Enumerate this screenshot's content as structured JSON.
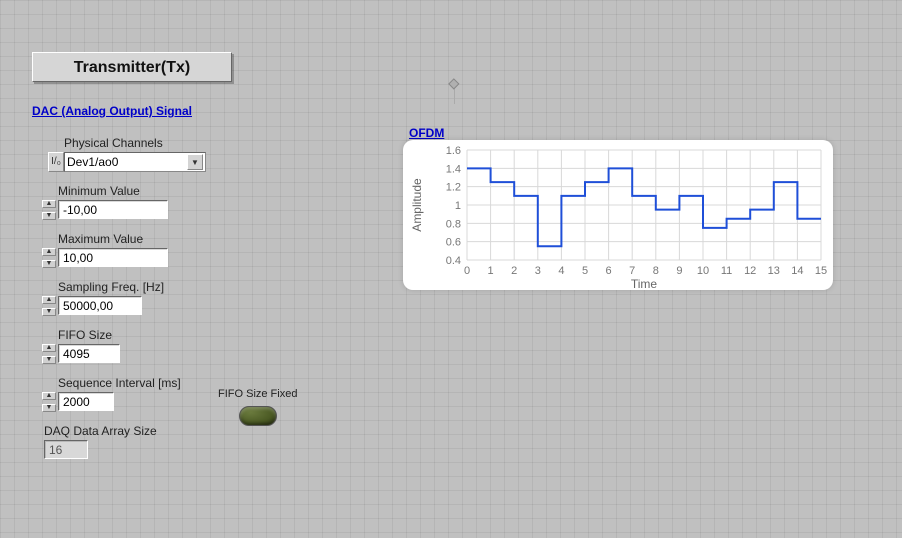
{
  "title": "Transmitter(Tx)",
  "section_header": "DAC (Analog Output) Signal",
  "channels": {
    "label": "Physical Channels",
    "value": "Dev1/ao0"
  },
  "min_value": {
    "label": "Minimum Value",
    "value": "-10,00"
  },
  "max_value": {
    "label": "Maximum Value",
    "value": "10,00"
  },
  "sampling": {
    "label": "Sampling Freq. [Hz]",
    "value": "50000,00"
  },
  "fifo": {
    "label": "FIFO Size",
    "value": "4095"
  },
  "seq": {
    "label": "Sequence Interval [ms]",
    "value": "2000"
  },
  "daq": {
    "label": "DAQ Data Array Size",
    "value": "16"
  },
  "fifo_fixed_label": "FIFO Size Fixed",
  "chart_title": "OFDM",
  "chart_data": {
    "type": "line",
    "title": "OFDM",
    "xlabel": "Time",
    "ylabel": "Amplitude",
    "xlim": [
      0,
      15
    ],
    "ylim": [
      0.4,
      1.6
    ],
    "x_ticks": [
      0,
      1,
      2,
      3,
      4,
      5,
      6,
      7,
      8,
      9,
      10,
      11,
      12,
      13,
      14,
      15
    ],
    "y_ticks": [
      0.4,
      0.6,
      0.8,
      1.0,
      1.2,
      1.4,
      1.6
    ],
    "y_tick_labels": [
      "0.4",
      "0.6",
      "0.8",
      "1",
      "1.2",
      "1.4",
      "1.6"
    ],
    "step_series": [
      {
        "x0": 0,
        "x1": 1,
        "y": 1.4
      },
      {
        "x0": 1,
        "x1": 2,
        "y": 1.25
      },
      {
        "x0": 2,
        "x1": 3,
        "y": 1.1
      },
      {
        "x0": 3,
        "x1": 4,
        "y": 0.55
      },
      {
        "x0": 4,
        "x1": 5,
        "y": 1.1
      },
      {
        "x0": 5,
        "x1": 6,
        "y": 1.25
      },
      {
        "x0": 6,
        "x1": 7,
        "y": 1.4
      },
      {
        "x0": 7,
        "x1": 8,
        "y": 1.1
      },
      {
        "x0": 8,
        "x1": 9,
        "y": 0.95
      },
      {
        "x0": 9,
        "x1": 10,
        "y": 1.1
      },
      {
        "x0": 10,
        "x1": 11,
        "y": 0.75
      },
      {
        "x0": 11,
        "x1": 12,
        "y": 0.85
      },
      {
        "x0": 12,
        "x1": 13,
        "y": 0.95
      },
      {
        "x0": 13,
        "x1": 14,
        "y": 1.25
      },
      {
        "x0": 14,
        "x1": 15,
        "y": 0.85
      }
    ]
  }
}
